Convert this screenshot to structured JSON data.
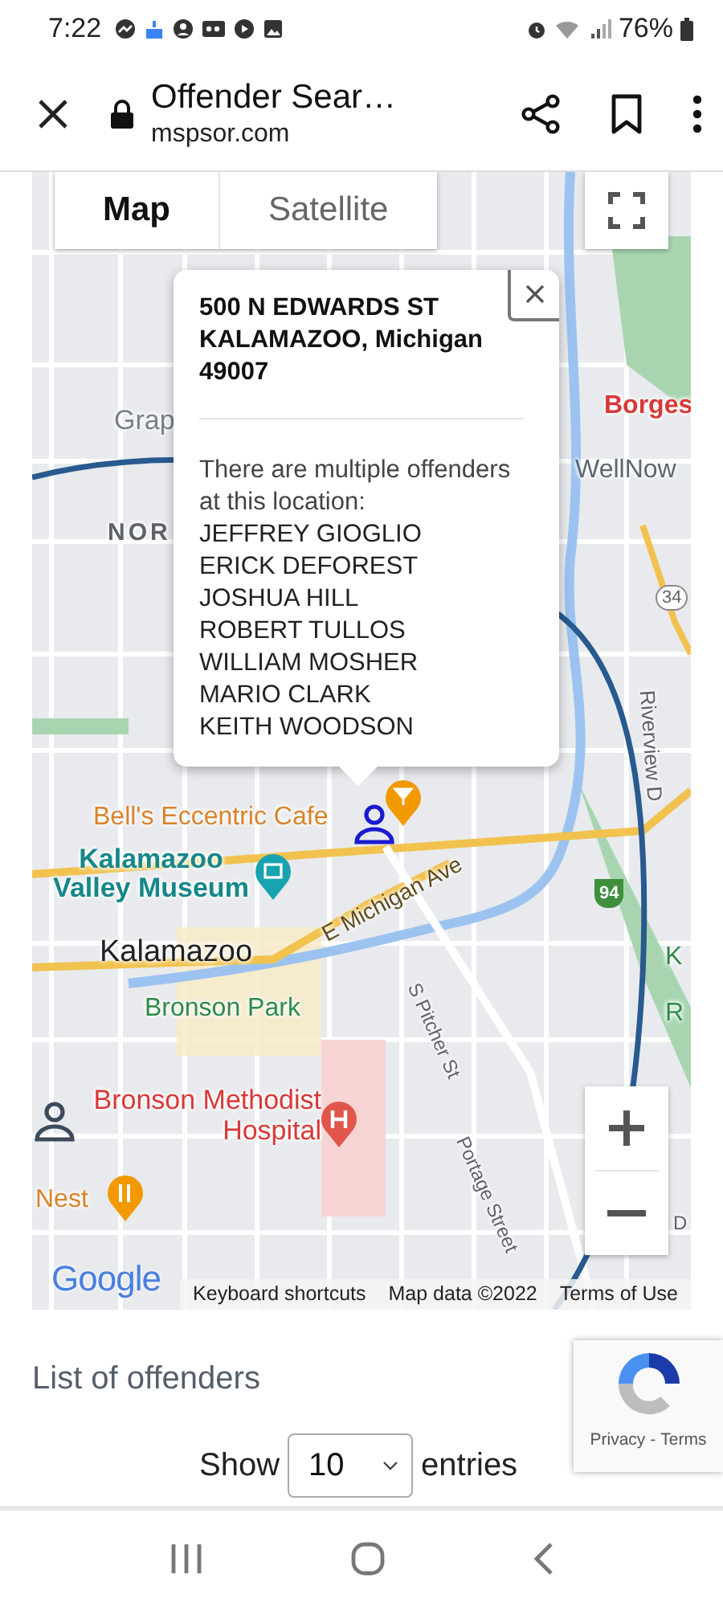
{
  "status_bar": {
    "time": "7:22",
    "battery": "76%"
  },
  "browser": {
    "title": "Offender Sear…",
    "url": "mspsor.com"
  },
  "map": {
    "type_tabs": [
      {
        "label": "Map",
        "selected": true
      },
      {
        "label": "Satellite",
        "selected": false
      }
    ],
    "labels": [
      {
        "text": "Grap",
        "kind": "area",
        "color": "#7a8088"
      },
      {
        "text": "NOR",
        "kind": "district",
        "color": "#5f6368"
      },
      {
        "text": "Borges",
        "kind": "place",
        "color": "#d93838"
      },
      {
        "text": "WellNow",
        "kind": "place",
        "color": "#5b6770"
      },
      {
        "text": "Bell's Eccentric Cafe",
        "kind": "place",
        "color": "#d9822b"
      },
      {
        "text": "Kalamazoo Valley Museum",
        "kind": "place",
        "color": "#16878a"
      },
      {
        "text": "Kalamazoo",
        "kind": "city",
        "color": "#202124"
      },
      {
        "text": "Bronson Park",
        "kind": "place",
        "color": "#2e8b4a"
      },
      {
        "text": "Bronson Methodist Hospital",
        "kind": "place",
        "color": "#d93838"
      },
      {
        "text": "Nest",
        "kind": "place",
        "color": "#d9822b"
      },
      {
        "text": "E Michigan Ave",
        "kind": "street",
        "color": "#5f4a1c"
      },
      {
        "text": "S Pitcher St",
        "kind": "street",
        "color": "#5f6368"
      },
      {
        "text": "Portage Street",
        "kind": "street",
        "color": "#5f6368"
      },
      {
        "text": "Riverview D",
        "kind": "street",
        "color": "#5f6368"
      },
      {
        "text": "34",
        "kind": "shield",
        "color": "#5f6368"
      },
      {
        "text": "94",
        "kind": "interstate",
        "color": "#3f8f3f"
      },
      {
        "text": "K",
        "kind": "place",
        "color": "#2e8b4a"
      },
      {
        "text": "R",
        "kind": "place",
        "color": "#2e8b4a"
      },
      {
        "text": "D",
        "kind": "street",
        "color": "#5f6368"
      }
    ],
    "info_window": {
      "address_lines": [
        "500 N EDWARDS ST",
        "KALAMAZOO, Michigan",
        "49007"
      ],
      "message": "There are multiple offenders at this location:",
      "offenders": [
        "JEFFREY GIOGLIO",
        "ERICK DEFOREST",
        "JOSHUA HILL",
        "ROBERT TULLOS",
        "WILLIAM MOSHER",
        "MARIO CLARK",
        "KEITH WOODSON"
      ]
    },
    "logo": "Google",
    "footer": [
      "Keyboard shortcuts",
      "Map data ©2022",
      "Terms of Use"
    ]
  },
  "list": {
    "heading": "List of offenders",
    "show_label": "Show",
    "page_size": "10",
    "entries_label": "entries"
  },
  "recaptcha": {
    "links": [
      "Privacy",
      "Terms"
    ],
    "separator": "-"
  }
}
